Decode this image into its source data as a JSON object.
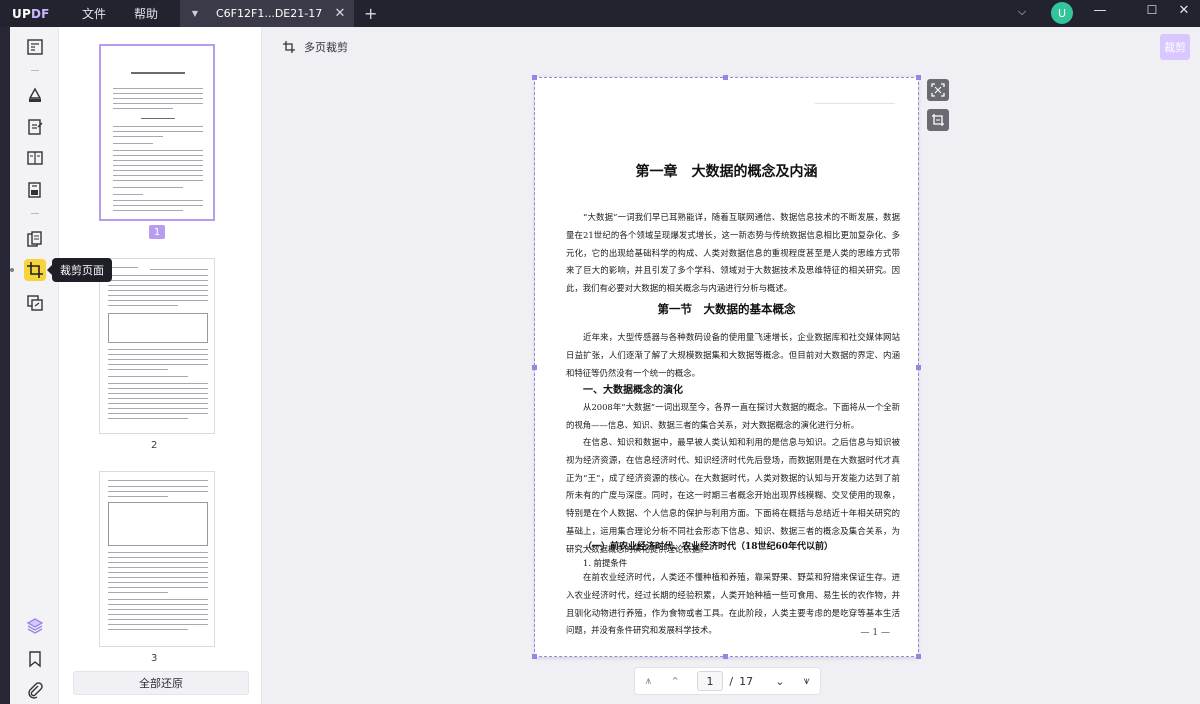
{
  "app": {
    "logo_up": "UP",
    "logo_pdf": "DF",
    "menu": [
      "文件",
      "帮助"
    ],
    "avatar_letter": "U"
  },
  "tab": {
    "title": "C6F12F1...DE21-17"
  },
  "toolbar": {
    "tooltip": "裁剪页面"
  },
  "thumbnails": {
    "pages": [
      "1",
      "2",
      "3"
    ],
    "restore_all": "全部还原"
  },
  "crop": {
    "header": "多页裁剪",
    "apply_label": "裁剪"
  },
  "document": {
    "chapter_title": "第一章　大数据的概念及内涵",
    "para1": "“大数据”一词我们早已耳熟能详，随着互联网通信、数据信息技术的不断发展，数据量在21世纪的各个领域呈现爆发式增长，这一新态势与传统数据信息相比更加复杂化、多元化，它的出现给基础科学的构成、人类对数据信息的重视程度甚至是人类的思维方式带来了巨大的影响，并且引发了多个学科、领域对于大数据技术及思维特征的相关研究。因此，我们有必要对大数据的相关概念与内涵进行分析与概述。",
    "section_title": "第一节　大数据的基本概念",
    "para2": "近年来，大型传感器与各种数码设备的使用量飞速增长，企业数据库和社交媒体网站日益扩张，人们逐渐了解了大规模数据集和大数据等概念。但目前对大数据的界定、内涵和特征等仍然没有一个统一的概念。",
    "heading1": "一、大数据概念的演化",
    "para3": "从2008年“大数据”一词出现至今，各界一直在探讨大数据的概念。下面将从一个全新的视角——信息、知识、数据三者的集合关系，对大数据概念的演化进行分析。",
    "para4": "在信息、知识和数据中，最早被人类认知和利用的是信息与知识。之后信息与知识被视为经济资源，在信息经济时代、知识经济时代先后登场，而数据则是在大数据时代才真正为“王”，成了经济资源的核心。在大数据时代，人类对数据的认知与开发能力达到了前所未有的广度与深度。同时，在这一时期三者概念开始出现界线模糊、交叉使用的现象，特别是在个人数据、个人信息的保护与利用方面。下面将在概括与总结近十年相关研究的基础上，运用集合理论分析不同社会形态下信息、知识、数据三者的概念及集合关系，为研究大数据概念的演化提供理论依据。",
    "heading2": "（一）前农业经济时代、农业经济时代（18世纪60年代以前）",
    "sub1": "1. 前提条件",
    "para5": "在前农业经济时代，人类还不懂种植和养殖，靠采野果、野菜和狩猎来保证生存。进入农业经济时代，经过长期的经验积累，人类开始种植一些可食用、易生长的农作物，并且驯化动物进行养殖，作为食物或者工具。在此阶段，人类主要考虑的是吃穿等基本生活问题，并没有条件研究和发展科学技术。",
    "page_footer": "— 1 —"
  },
  "pager": {
    "current": "1",
    "separator": "/",
    "total": "17"
  }
}
